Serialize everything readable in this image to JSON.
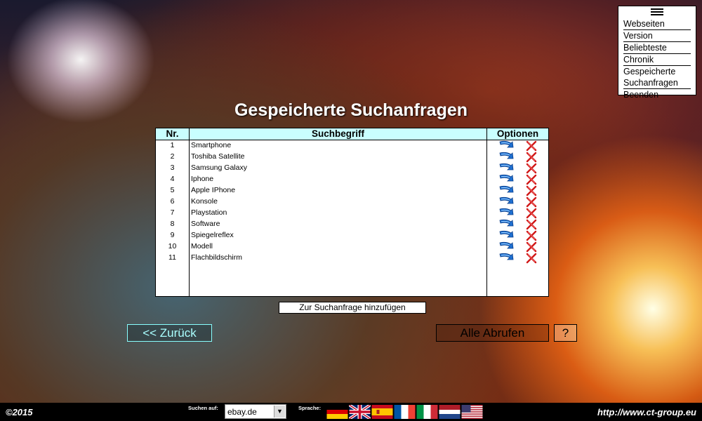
{
  "menu": {
    "icon": "hamburger-icon",
    "items": [
      {
        "label": "Webseiten"
      },
      {
        "label": "Version"
      },
      {
        "label": "Beliebteste"
      },
      {
        "label": "Chronik"
      },
      {
        "label": "Gespeicherte"
      },
      {
        "label": "Suchanfragen"
      },
      {
        "label": "Beenden"
      }
    ]
  },
  "page_title": "Gespeicherte Suchanfragen",
  "table": {
    "headers": {
      "nr": "Nr.",
      "term": "Suchbegriff",
      "options": "Optionen"
    },
    "rows": [
      {
        "nr": "1",
        "term": "Smartphone"
      },
      {
        "nr": "2",
        "term": "Toshiba Satellite"
      },
      {
        "nr": "3",
        "term": "Samsung Galaxy"
      },
      {
        "nr": "4",
        "term": "Iphone"
      },
      {
        "nr": "5",
        "term": "Apple IPhone"
      },
      {
        "nr": "6",
        "term": "Konsole"
      },
      {
        "nr": "7",
        "term": "Playstation"
      },
      {
        "nr": "8",
        "term": "Software"
      },
      {
        "nr": "9",
        "term": "Spiegelreflex"
      },
      {
        "nr": "10",
        "term": "Modell"
      },
      {
        "nr": "11",
        "term": "Flachbildschirm"
      }
    ],
    "row_icons": [
      "blue-down-arrow-icon",
      "red-x-delete-icon"
    ]
  },
  "buttons": {
    "add": "Zur Suchanfrage hinzufügen",
    "back": "<< Zurück",
    "all": "Alle Abrufen",
    "help": "?"
  },
  "footer": {
    "copyright": "©2015",
    "search_label": "Suchen auf:",
    "search_engine": "ebay.de",
    "language_label": "Sprache:",
    "flags": [
      "german-flag-icon",
      "uk-flag-icon",
      "spanish-flag-icon",
      "french-flag-icon",
      "italian-flag-icon",
      "dutch-flag-icon",
      "us-flag-icon"
    ],
    "url": "http://www.ct-group.eu"
  }
}
